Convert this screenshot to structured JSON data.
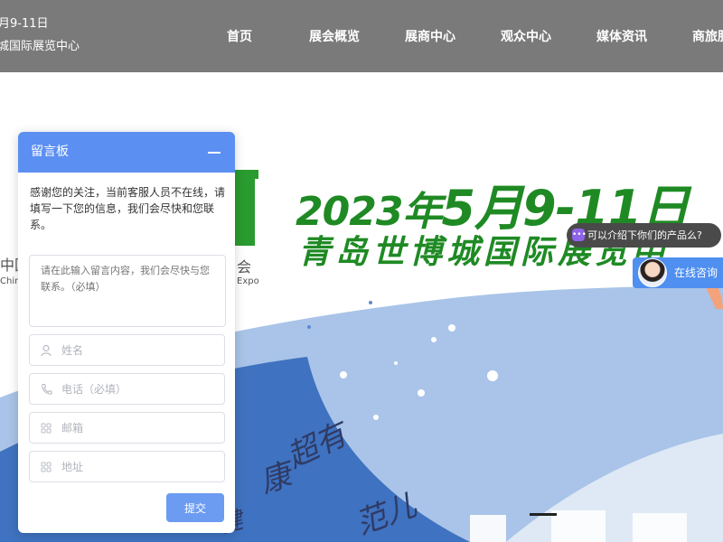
{
  "header": {
    "date_line": "月9-11日",
    "venue_line": "城国际展览中心",
    "nav": [
      "首页",
      "展会概览",
      "展商中心",
      "观众中心",
      "媒体资讯",
      "商旅服"
    ]
  },
  "hero": {
    "date_prefix": "2023年",
    "date_big": "5月9-11日",
    "venue": "青岛世博城国际展览中",
    "logo_cn": "中国",
    "logo_cn_tail": "会",
    "logo_en_head": "Chin",
    "logo_en_tail": "Expo",
    "slogan_a": "康",
    "slogan_b": "超有",
    "slogan_c": "范儿",
    "slogan_d": "健"
  },
  "chat": {
    "bubble_text": "可以介绍下你们的产品么?",
    "consult_label": "在线咨询"
  },
  "board": {
    "title": "留言板",
    "intro": "感谢您的关注，当前客服人员不在线，请填写一下您的信息，我们会尽快和您联系。",
    "message_placeholder": "请在此输入留言内容，我们会尽快与您联系。（必填）",
    "name_placeholder": "姓名",
    "phone_placeholder": "电话（必填）",
    "email_placeholder": "邮箱",
    "address_placeholder": "地址",
    "submit_label": "提交"
  },
  "colors": {
    "header_bg": "#7a7a7a",
    "accent_green": "#1f8a24",
    "board_blue": "#5b8ff2",
    "wave_light": "#a9c4e8",
    "wave_dark": "#3f72c0"
  },
  "icons": {
    "name": "user-icon",
    "phone": "phone-icon",
    "email": "grid-icon",
    "address": "grid-icon",
    "bubble": "chat-icon"
  }
}
